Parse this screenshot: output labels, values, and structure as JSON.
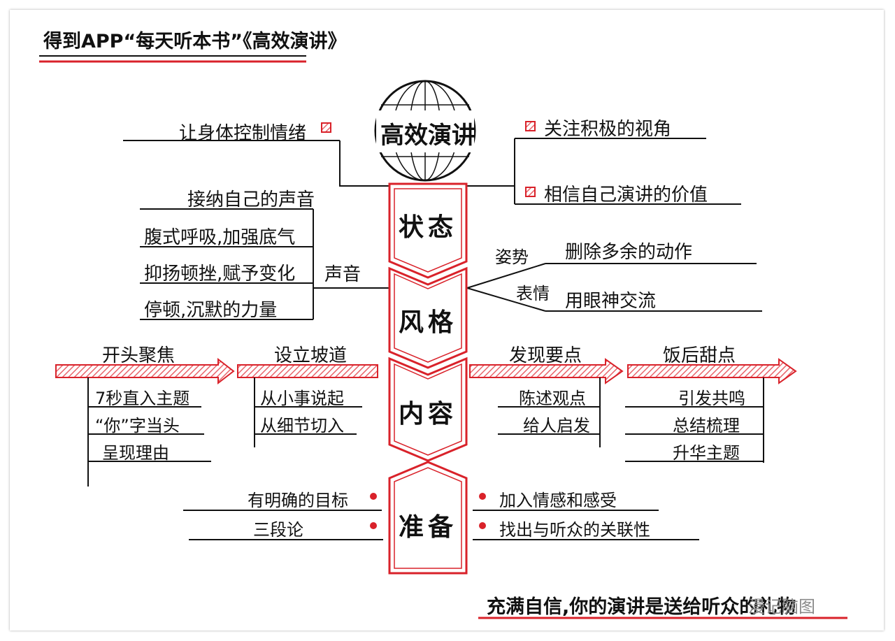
{
  "title": "得到APP“每天听本书”《高效演讲》",
  "center": "高效演讲",
  "spine": [
    "状态",
    "风格",
    "内容",
    "准备"
  ],
  "status": {
    "left": "让身体控制情绪",
    "right": [
      "关注积极的视角",
      "相信自己演讲的价值"
    ]
  },
  "voice": {
    "label": "声音",
    "items": [
      "接纳自己的声音",
      "腹式呼吸,加强底气",
      "抑扬顿挫,赋予变化",
      "停顿,沉默的力量"
    ]
  },
  "style_right": {
    "posture_label": "姿势",
    "posture": "删除多余的动作",
    "expression_label": "表情",
    "expression": "用眼神交流"
  },
  "content": {
    "groups": [
      {
        "head": "开头聚焦",
        "items": [
          "7秒直入主题",
          "“你”字当头",
          "呈现理由"
        ]
      },
      {
        "head": "设立坡道",
        "items": [
          "从小事说起",
          "从细节切入"
        ]
      },
      {
        "head": "发现要点",
        "items": [
          "陈述观点",
          "给人启发"
        ]
      },
      {
        "head": "饭后甜点",
        "items": [
          "引发共鸣",
          "总结梳理",
          "升华主题"
        ]
      }
    ]
  },
  "prep": {
    "left": [
      "有明确的目标",
      "三段论"
    ],
    "right": [
      "加入情感和感受",
      "找出与听众的关联性"
    ]
  },
  "footer": "充满自信,你的演讲是送给听众的礼物",
  "watermark": "漫记脑图",
  "colors": {
    "accent": "#d9222a",
    "ink": "#111111",
    "hatch": "#e8636a"
  }
}
